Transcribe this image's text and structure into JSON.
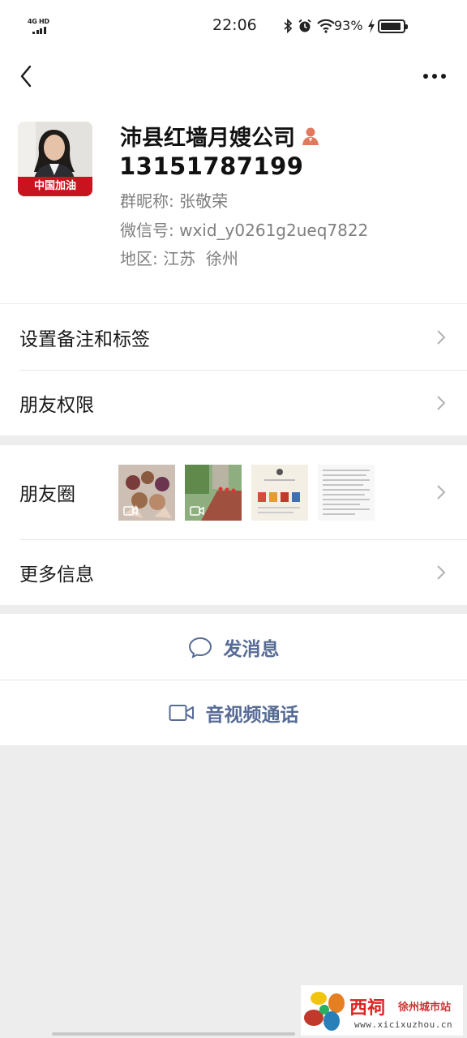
{
  "status_bar": {
    "network": "4G HD",
    "time": "22:06",
    "battery": "93%",
    "battery_level": 0.93
  },
  "profile": {
    "name": "沛县红墙月嫂公司",
    "phone": "13151787199",
    "avatar_banner": "中国加油",
    "group_nickname_label": "群昵称:",
    "group_nickname": "张敬荣",
    "wechat_id_label": "微信号:",
    "wechat_id": "wxid_y0261g2ueq7822",
    "region_label": "地区:",
    "region": "江苏  徐州"
  },
  "settings": {
    "remark_label": "设置备注和标签",
    "permissions_label": "朋友权限"
  },
  "moments": {
    "label": "朋友圈",
    "more_info_label": "更多信息"
  },
  "actions": {
    "message_label": "发消息",
    "call_label": "音视频通话"
  },
  "watermark": {
    "brand": "西祠",
    "sub": "徐州城市站",
    "url": "www.xicixuzhou.cn"
  },
  "colors": {
    "link": "#576b95",
    "background": "#ededed",
    "avatar_banner": "#c8141e"
  },
  "icons": [
    "back-arrow-icon",
    "more-dots-icon",
    "contact-person-icon",
    "chevron-right-icon",
    "chat-bubble-icon",
    "video-camera-icon"
  ]
}
